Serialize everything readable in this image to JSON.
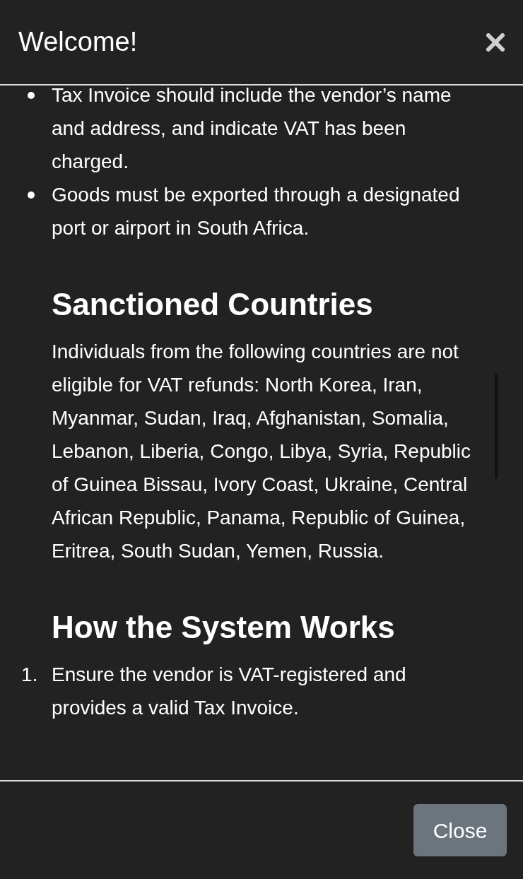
{
  "dialog": {
    "title": "Welcome!",
    "sections": [
      {
        "kind": "bullets",
        "items": [
          "Tax Invoice should include the vendor’s name and address, and indicate VAT has been charged.",
          "Goods must be exported through a designated port or airport in South Africa."
        ]
      },
      {
        "kind": "heading",
        "text": "Sanctioned Countries"
      },
      {
        "kind": "paragraph",
        "text": "Individuals from the following countries are not eligible for VAT refunds: North Korea, Iran, Myanmar, Sudan, Iraq, Afghanistan, Somalia, Lebanon, Liberia, Congo, Libya, Syria, Republic of Guinea Bissau, Ivory Coast, Ukraine, Central African Republic, Panama, Republic of Guinea, Eritrea, South Sudan, Yemen, Russia."
      },
      {
        "kind": "heading",
        "text": "How the System Works"
      },
      {
        "kind": "numbered",
        "items": [
          {
            "number": "1.",
            "text": "Ensure the vendor is VAT-registered and provides a valid Tax Invoice."
          }
        ]
      }
    ],
    "footer_button": "Close"
  }
}
